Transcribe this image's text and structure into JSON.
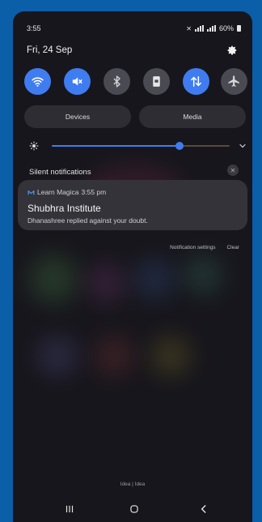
{
  "status_bar": {
    "time": "3:55",
    "battery": "60%"
  },
  "header": {
    "date": "Fri, 24 Sep"
  },
  "quick_settings": [
    {
      "id": "wifi",
      "icon": "wifi-icon",
      "state": "on"
    },
    {
      "id": "sound",
      "icon": "mute-icon",
      "state": "on"
    },
    {
      "id": "bluetooth",
      "icon": "bluetooth-icon",
      "state": "off"
    },
    {
      "id": "rotation",
      "icon": "portrait-lock-icon",
      "state": "off"
    },
    {
      "id": "mobile-data",
      "icon": "mobile-data-icon",
      "state": "on"
    },
    {
      "id": "airplane",
      "icon": "airplane-icon",
      "state": "off"
    }
  ],
  "pills": {
    "devices": "Devices",
    "media": "Media"
  },
  "brightness": {
    "level": 0.72
  },
  "silent_notifications": {
    "label": "Silent notifications"
  },
  "notification": {
    "app": "Learn Magica",
    "time": "3:55 pm",
    "title": "Shubhra Institute",
    "body": "Dhanashree replied against your doubt."
  },
  "notification_actions": {
    "settings": "Notification settings",
    "clear": "Clear"
  },
  "carrier": "Idea | Idea",
  "colors": {
    "accent": "#3f7cf0",
    "frame": "#0b5ea8"
  }
}
